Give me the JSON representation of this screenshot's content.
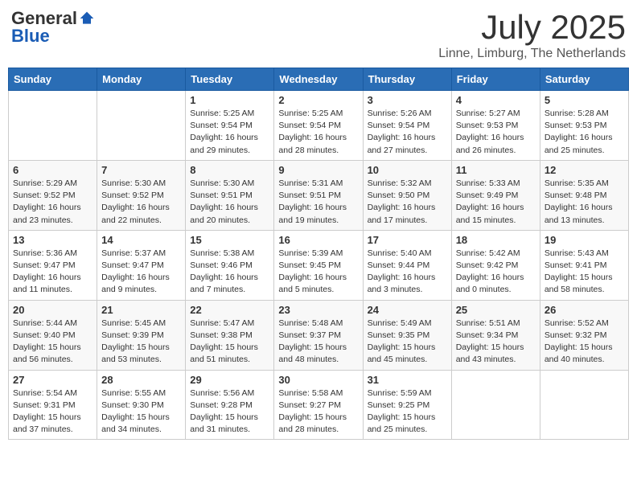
{
  "header": {
    "logo_general": "General",
    "logo_blue": "Blue",
    "month_title": "July 2025",
    "location": "Linne, Limburg, The Netherlands"
  },
  "weekdays": [
    "Sunday",
    "Monday",
    "Tuesday",
    "Wednesday",
    "Thursday",
    "Friday",
    "Saturday"
  ],
  "weeks": [
    [
      {
        "day": "",
        "info": ""
      },
      {
        "day": "",
        "info": ""
      },
      {
        "day": "1",
        "info": "Sunrise: 5:25 AM\nSunset: 9:54 PM\nDaylight: 16 hours\nand 29 minutes."
      },
      {
        "day": "2",
        "info": "Sunrise: 5:25 AM\nSunset: 9:54 PM\nDaylight: 16 hours\nand 28 minutes."
      },
      {
        "day": "3",
        "info": "Sunrise: 5:26 AM\nSunset: 9:54 PM\nDaylight: 16 hours\nand 27 minutes."
      },
      {
        "day": "4",
        "info": "Sunrise: 5:27 AM\nSunset: 9:53 PM\nDaylight: 16 hours\nand 26 minutes."
      },
      {
        "day": "5",
        "info": "Sunrise: 5:28 AM\nSunset: 9:53 PM\nDaylight: 16 hours\nand 25 minutes."
      }
    ],
    [
      {
        "day": "6",
        "info": "Sunrise: 5:29 AM\nSunset: 9:52 PM\nDaylight: 16 hours\nand 23 minutes."
      },
      {
        "day": "7",
        "info": "Sunrise: 5:30 AM\nSunset: 9:52 PM\nDaylight: 16 hours\nand 22 minutes."
      },
      {
        "day": "8",
        "info": "Sunrise: 5:30 AM\nSunset: 9:51 PM\nDaylight: 16 hours\nand 20 minutes."
      },
      {
        "day": "9",
        "info": "Sunrise: 5:31 AM\nSunset: 9:51 PM\nDaylight: 16 hours\nand 19 minutes."
      },
      {
        "day": "10",
        "info": "Sunrise: 5:32 AM\nSunset: 9:50 PM\nDaylight: 16 hours\nand 17 minutes."
      },
      {
        "day": "11",
        "info": "Sunrise: 5:33 AM\nSunset: 9:49 PM\nDaylight: 16 hours\nand 15 minutes."
      },
      {
        "day": "12",
        "info": "Sunrise: 5:35 AM\nSunset: 9:48 PM\nDaylight: 16 hours\nand 13 minutes."
      }
    ],
    [
      {
        "day": "13",
        "info": "Sunrise: 5:36 AM\nSunset: 9:47 PM\nDaylight: 16 hours\nand 11 minutes."
      },
      {
        "day": "14",
        "info": "Sunrise: 5:37 AM\nSunset: 9:47 PM\nDaylight: 16 hours\nand 9 minutes."
      },
      {
        "day": "15",
        "info": "Sunrise: 5:38 AM\nSunset: 9:46 PM\nDaylight: 16 hours\nand 7 minutes."
      },
      {
        "day": "16",
        "info": "Sunrise: 5:39 AM\nSunset: 9:45 PM\nDaylight: 16 hours\nand 5 minutes."
      },
      {
        "day": "17",
        "info": "Sunrise: 5:40 AM\nSunset: 9:44 PM\nDaylight: 16 hours\nand 3 minutes."
      },
      {
        "day": "18",
        "info": "Sunrise: 5:42 AM\nSunset: 9:42 PM\nDaylight: 16 hours\nand 0 minutes."
      },
      {
        "day": "19",
        "info": "Sunrise: 5:43 AM\nSunset: 9:41 PM\nDaylight: 15 hours\nand 58 minutes."
      }
    ],
    [
      {
        "day": "20",
        "info": "Sunrise: 5:44 AM\nSunset: 9:40 PM\nDaylight: 15 hours\nand 56 minutes."
      },
      {
        "day": "21",
        "info": "Sunrise: 5:45 AM\nSunset: 9:39 PM\nDaylight: 15 hours\nand 53 minutes."
      },
      {
        "day": "22",
        "info": "Sunrise: 5:47 AM\nSunset: 9:38 PM\nDaylight: 15 hours\nand 51 minutes."
      },
      {
        "day": "23",
        "info": "Sunrise: 5:48 AM\nSunset: 9:37 PM\nDaylight: 15 hours\nand 48 minutes."
      },
      {
        "day": "24",
        "info": "Sunrise: 5:49 AM\nSunset: 9:35 PM\nDaylight: 15 hours\nand 45 minutes."
      },
      {
        "day": "25",
        "info": "Sunrise: 5:51 AM\nSunset: 9:34 PM\nDaylight: 15 hours\nand 43 minutes."
      },
      {
        "day": "26",
        "info": "Sunrise: 5:52 AM\nSunset: 9:32 PM\nDaylight: 15 hours\nand 40 minutes."
      }
    ],
    [
      {
        "day": "27",
        "info": "Sunrise: 5:54 AM\nSunset: 9:31 PM\nDaylight: 15 hours\nand 37 minutes."
      },
      {
        "day": "28",
        "info": "Sunrise: 5:55 AM\nSunset: 9:30 PM\nDaylight: 15 hours\nand 34 minutes."
      },
      {
        "day": "29",
        "info": "Sunrise: 5:56 AM\nSunset: 9:28 PM\nDaylight: 15 hours\nand 31 minutes."
      },
      {
        "day": "30",
        "info": "Sunrise: 5:58 AM\nSunset: 9:27 PM\nDaylight: 15 hours\nand 28 minutes."
      },
      {
        "day": "31",
        "info": "Sunrise: 5:59 AM\nSunset: 9:25 PM\nDaylight: 15 hours\nand 25 minutes."
      },
      {
        "day": "",
        "info": ""
      },
      {
        "day": "",
        "info": ""
      }
    ]
  ]
}
